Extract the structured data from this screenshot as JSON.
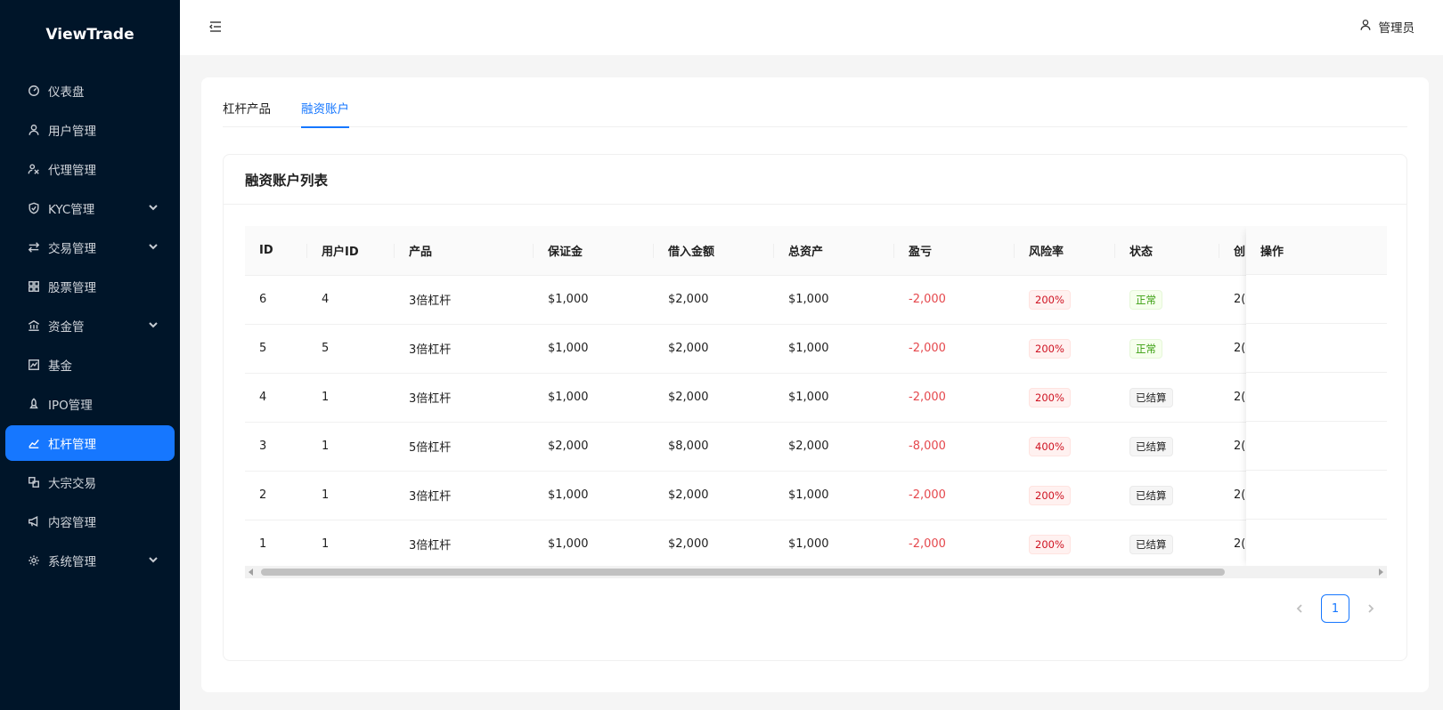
{
  "app": {
    "title": "ViewTrade"
  },
  "header": {
    "user_name": "管理员"
  },
  "sidebar": {
    "items": [
      {
        "label": "仪表盘",
        "icon": "dashboard-icon",
        "has_caret": false,
        "active": false
      },
      {
        "label": "用户管理",
        "icon": "user-icon",
        "has_caret": false,
        "active": false
      },
      {
        "label": "代理管理",
        "icon": "agent-icon",
        "has_caret": false,
        "active": false
      },
      {
        "label": "KYC管理",
        "icon": "shield-icon",
        "has_caret": true,
        "active": false
      },
      {
        "label": "交易管理",
        "icon": "swap-icon",
        "has_caret": true,
        "active": false
      },
      {
        "label": "股票管理",
        "icon": "grid-icon",
        "has_caret": false,
        "active": false
      },
      {
        "label": "资金管",
        "icon": "bank-icon",
        "has_caret": true,
        "active": false
      },
      {
        "label": "基金",
        "icon": "fund-chart-icon",
        "has_caret": false,
        "active": false
      },
      {
        "label": "IPO管理",
        "icon": "rocket-icon",
        "has_caret": false,
        "active": false
      },
      {
        "label": "杠杆管理",
        "icon": "line-chart-icon",
        "has_caret": false,
        "active": true
      },
      {
        "label": "大宗交易",
        "icon": "block-icon",
        "has_caret": false,
        "active": false
      },
      {
        "label": "内容管理",
        "icon": "megaphone-icon",
        "has_caret": false,
        "active": false
      },
      {
        "label": "系统管理",
        "icon": "settings-icon",
        "has_caret": true,
        "active": false
      }
    ]
  },
  "tabs": [
    {
      "label": "杠杆产品",
      "active": false
    },
    {
      "label": "融资账户",
      "active": true
    }
  ],
  "card": {
    "title": "融资账户列表"
  },
  "table": {
    "columns": [
      "ID",
      "用户ID",
      "产品",
      "保证金",
      "借入金额",
      "总资产",
      "盈亏",
      "风险率",
      "状态",
      "创",
      "操作"
    ],
    "rows": [
      {
        "id": "6",
        "user_id": "4",
        "product": "3倍杠杆",
        "margin": "$1,000",
        "borrowed": "$2,000",
        "total": "$1,000",
        "pnl": "-2,000",
        "risk": "200%",
        "status": "正常",
        "status_type": "ok",
        "created": "2("
      },
      {
        "id": "5",
        "user_id": "5",
        "product": "3倍杠杆",
        "margin": "$1,000",
        "borrowed": "$2,000",
        "total": "$1,000",
        "pnl": "-2,000",
        "risk": "200%",
        "status": "正常",
        "status_type": "ok",
        "created": "2("
      },
      {
        "id": "4",
        "user_id": "1",
        "product": "3倍杠杆",
        "margin": "$1,000",
        "borrowed": "$2,000",
        "total": "$1,000",
        "pnl": "-2,000",
        "risk": "200%",
        "status": "已结算",
        "status_type": "done",
        "created": "2("
      },
      {
        "id": "3",
        "user_id": "1",
        "product": "5倍杠杆",
        "margin": "$2,000",
        "borrowed": "$8,000",
        "total": "$2,000",
        "pnl": "-8,000",
        "risk": "400%",
        "status": "已结算",
        "status_type": "done",
        "created": "2("
      },
      {
        "id": "2",
        "user_id": "1",
        "product": "3倍杠杆",
        "margin": "$1,000",
        "borrowed": "$2,000",
        "total": "$1,000",
        "pnl": "-2,000",
        "risk": "200%",
        "status": "已结算",
        "status_type": "done",
        "created": "2("
      },
      {
        "id": "1",
        "user_id": "1",
        "product": "3倍杠杆",
        "margin": "$1,000",
        "borrowed": "$2,000",
        "total": "$1,000",
        "pnl": "-2,000",
        "risk": "200%",
        "status": "已结算",
        "status_type": "done",
        "created": "2("
      }
    ]
  },
  "pagination": {
    "current_page": "1"
  },
  "colors": {
    "primary": "#1677ff",
    "sidebar_bg": "#001529",
    "loss": "#e5484d"
  }
}
